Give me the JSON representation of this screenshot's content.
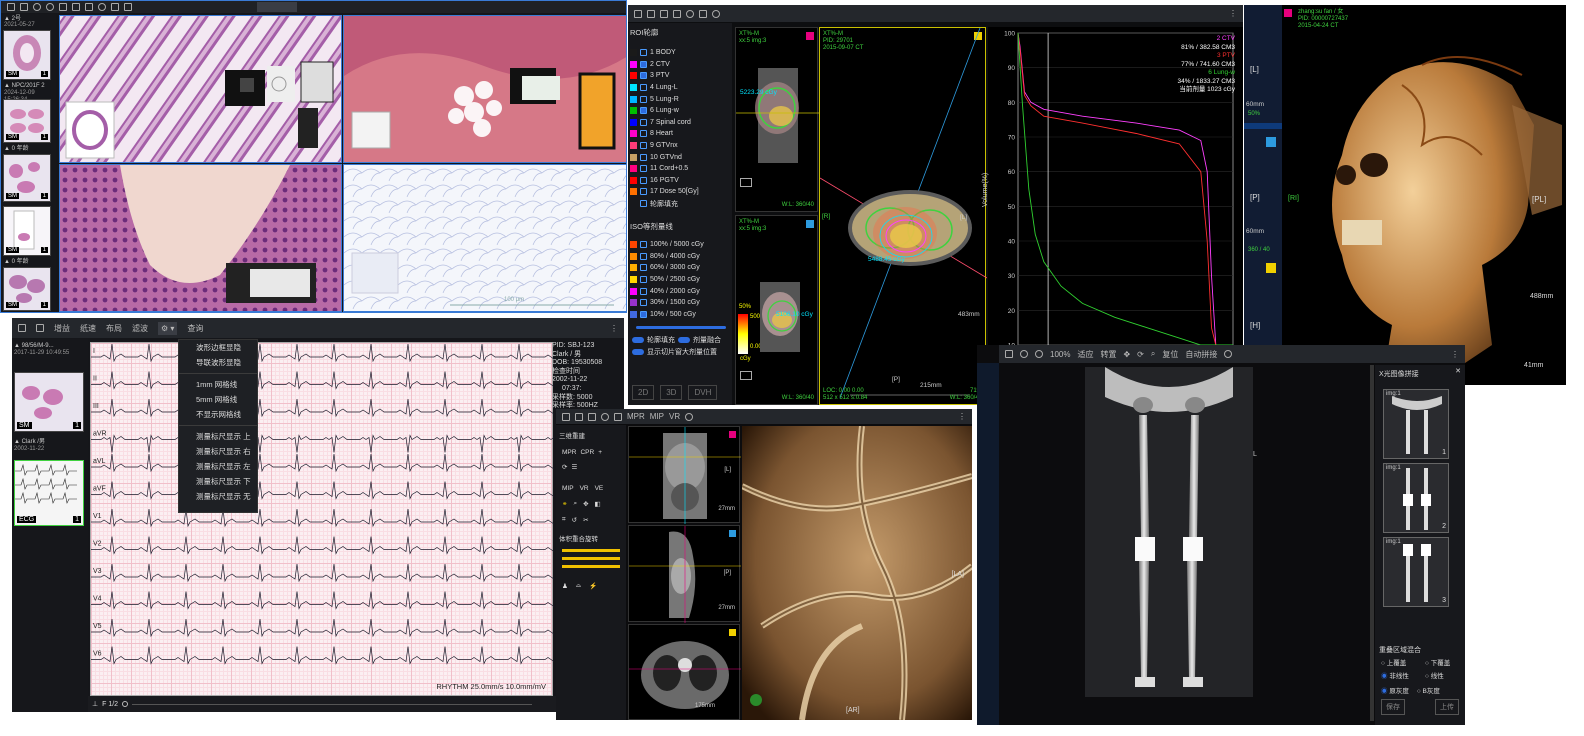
{
  "colors": {
    "accent": "#2d6cdf",
    "green": "#3fd23f",
    "yellow": "#f0d000",
    "magenta": "#e6007e"
  },
  "pathology": {
    "sidebar": {
      "header_line1": "▲ 2号",
      "header_line2": "2021-05-27",
      "group2_line1": "▲ NPC/201F 2",
      "group2_line2": "2024-12-09 15:26:34",
      "group3_line1": "▲ 0 年龄",
      "group4_line1": "▲ 0 年龄",
      "thumbs": [
        {
          "tag": "SM",
          "num": "1"
        },
        {
          "tag": "SM",
          "num": "1"
        },
        {
          "tag": "SM",
          "num": "1"
        },
        {
          "tag": "SM",
          "num": "1"
        },
        {
          "tag": "SM",
          "num": "1"
        }
      ]
    },
    "scale_label": "100 μm"
  },
  "rt": {
    "toolbar_icons": [
      "layout-icon",
      "grid-icon",
      "pointer-icon",
      "window-icon",
      "zoom-icon",
      "ruler-icon",
      "close-icon"
    ],
    "roi_title": "ROI轮廓",
    "roi_items": [
      {
        "label": "1 BODY",
        "color": "#1a1a1a",
        "checked": false
      },
      {
        "label": "2 CTV",
        "color": "#ff00ff",
        "checked": true
      },
      {
        "label": "3 PTV",
        "color": "#ff0000",
        "checked": true
      },
      {
        "label": "4 Lung-L",
        "color": "#00e5ff",
        "checked": false
      },
      {
        "label": "5 Lung-R",
        "color": "#00b7ff",
        "checked": false
      },
      {
        "label": "6 Lung-w",
        "color": "#00c000",
        "checked": true
      },
      {
        "label": "7 Spinal cord",
        "color": "#0000ff",
        "checked": false
      },
      {
        "label": "8 Heart",
        "color": "#ff00c8",
        "checked": false
      },
      {
        "label": "9 GTVnx",
        "color": "#ff3c78",
        "checked": false
      },
      {
        "label": "10 GTVnd",
        "color": "#c8a064",
        "checked": false
      },
      {
        "label": "11 Cord+0.5",
        "color": "#ff0080",
        "checked": false
      },
      {
        "label": "16 PGTV",
        "color": "#ff0000",
        "checked": false
      },
      {
        "label": "17 Dose 50[Gy]",
        "color": "#ff7000",
        "checked": false
      },
      {
        "label": "轮廓填充",
        "color": "",
        "checked": false
      }
    ],
    "iso_title": "ISO等剂量线",
    "iso_items": [
      {
        "label": "100% / 5000 cGy",
        "color": "#ff4500",
        "checked": false
      },
      {
        "label": "80% / 4000 cGy",
        "color": "#ff8c00",
        "checked": false
      },
      {
        "label": "60% / 3000 cGy",
        "color": "#ffb000",
        "checked": false
      },
      {
        "label": "50% / 2500 cGy",
        "color": "#ffd700",
        "checked": false
      },
      {
        "label": "40% / 2000 cGy",
        "color": "#ff00ff",
        "checked": false
      },
      {
        "label": "30% / 1500 cGy",
        "color": "#9932cc",
        "checked": false
      },
      {
        "label": "10% / 500 cGy",
        "color": "#4169e1",
        "checked": true
      }
    ],
    "toggle1_a": "轮廓填充",
    "toggle1_b": "剂量融合",
    "toggle2": "显示切片窗大剂量位置",
    "buttons": [
      "2D",
      "3D",
      "DVH"
    ],
    "view1_info": "XT%-M\nxx:5 img:3",
    "view_bottom": "W:L: 360/40",
    "dose_scale": [
      "50%",
      "5000",
      "0.00",
      "cGy"
    ],
    "axial_labels": {
      "r": "[R]",
      "l": "[L]",
      "p": "[P]",
      "a": "[A]"
    },
    "axial_info": "XT%-M\nPID: 29701\n2015-09-07 CT",
    "dose_label_1": "5488.45 cGy",
    "dose_label_2": "5223.29 cGy",
    "dose_label_3": "5106.10 cGy",
    "ruler_label": "215mm",
    "size_label": "483mm",
    "loc_label": "LOC: 0.00 0.00\n512 x 512 s:0.84",
    "pct_label": "71%\nW:L: 360/40",
    "dvh": {
      "ylabel": "Volume(%)",
      "legend": [
        {
          "text": "2 CTV",
          "color": "#ff40ff"
        },
        {
          "text": "81% / 382.58 CM3",
          "color": "#ffffff"
        },
        {
          "text": "3 PTV",
          "color": "#ff3030"
        },
        {
          "text": "77% / 741.60 CM3",
          "color": "#ffffff"
        },
        {
          "text": "6 Lung-w",
          "color": "#30d030"
        },
        {
          "text": "34% / 1833.27 CM3",
          "color": "#ffffff"
        },
        {
          "text": "当前剂量 1023 cGy",
          "color": "#ffffff"
        }
      ]
    }
  },
  "chart_data": {
    "type": "line",
    "title": "",
    "xlabel": "",
    "ylabel": "Volume(%)",
    "ylim": [
      10,
      100
    ],
    "yticks": [
      100,
      90,
      80,
      70,
      60,
      50,
      40,
      30,
      20,
      10
    ],
    "x_domain": [
      0,
      100
    ],
    "series": [
      {
        "name": "2 CTV",
        "color": "#ff40ff",
        "x": [
          0,
          1,
          3,
          6,
          12,
          30,
          55,
          75,
          85,
          88,
          90,
          92,
          100
        ],
        "y": [
          100,
          96,
          83,
          80,
          78,
          76,
          74,
          72,
          69,
          60,
          30,
          10,
          10
        ]
      },
      {
        "name": "3 PTV",
        "color": "#ff3030",
        "x": [
          0,
          1,
          3,
          6,
          12,
          30,
          55,
          75,
          85,
          88,
          90,
          92,
          100
        ],
        "y": [
          100,
          95,
          82,
          79,
          76,
          74,
          71,
          68,
          60,
          40,
          15,
          10,
          10
        ]
      },
      {
        "name": "6 Lung-w",
        "color": "#30d030",
        "x": [
          0,
          2,
          5,
          8,
          12,
          20,
          30,
          45,
          60,
          75,
          85,
          100
        ],
        "y": [
          100,
          80,
          55,
          42,
          34,
          27,
          22,
          18,
          15,
          12,
          10,
          10
        ]
      }
    ],
    "cursor_x": 14
  },
  "skull3d": {
    "info": "zhang:su fan / 女\nPID: 00000727437\n2015-04-24 CT",
    "orient": {
      "l": "[L]",
      "pl": "[PL]",
      "p": "[P]",
      "ri": "[RI]",
      "h": "[H]"
    },
    "side_labels": [
      "60mm",
      "50%",
      "360 / 40"
    ],
    "size_label": "488mm",
    "bottom_label": "41mm",
    "scale2": "60mm"
  },
  "ecg": {
    "toolbar": [
      "增益",
      "纸速",
      "布局",
      "滤波",
      "设置",
      "查询"
    ],
    "sidebar": {
      "group1_line1": "▲ 98/56/M-9...",
      "group1_line2": "2017-11-29 10:49:55",
      "group1_tag": "SM",
      "group1_num": "1",
      "group2_line1": "▲ Clark /男",
      "group2_line2": "2002-11-22",
      "group2_tag": "ECG",
      "group2_num": "1"
    },
    "leads": [
      "I",
      "II",
      "III",
      "aVR",
      "aVL",
      "aVF",
      "V1",
      "V2",
      "V3",
      "V4",
      "V5",
      "V6"
    ],
    "patient": {
      "pid": "PID: SBJ-123",
      "name": "Clark / 男",
      "dob": "DOB: 19530508",
      "exam": "检查时间",
      "date": "2002-11-22",
      "time": "07:37:",
      "samples": "采样数: 5000",
      "rate": "采样率: 500HZ"
    },
    "rhythm": "RHYTHM 25.0mm/s 10.0mm/mV",
    "page": "F 1/2",
    "menu": [
      "波形边框显隐",
      "导联波形显隐",
      "1mm 网格线",
      "5mm 网格线",
      "不显示网格线",
      "测量标尺显示 上",
      "测量标尺显示 右",
      "测量标尺显示 左",
      "测量标尺显示 下",
      "测量标尺显示 无"
    ]
  },
  "mpr": {
    "toolbar": [
      "MPR",
      "MIP",
      "VR"
    ],
    "panel_title": "三维重建",
    "row1": [
      "MPR",
      "CPR"
    ],
    "row2": [
      "MIP",
      "VR",
      "VE"
    ],
    "section2": "体积重合旋转",
    "views": [
      {
        "lbl": "[L]",
        "mm": "27mm",
        "sub": "[P]"
      },
      {
        "lbl": "[P]",
        "mm": "27mm",
        "sub": ""
      },
      {
        "lbl": "[L]",
        "mm": "175mm",
        "sub": ""
      }
    ],
    "vr_labels": {
      "la": "[LA]",
      "ar": "[AR]"
    }
  },
  "xray": {
    "toolbar": [
      "100%",
      "适应",
      "转置",
      "复位",
      "自动拼接"
    ],
    "side_title": "X光图像拼接",
    "thumbs": [
      {
        "lbl": "img:1",
        "n": "1"
      },
      {
        "lbl": "img:1",
        "n": "2"
      },
      {
        "lbl": "img:1",
        "n": "3"
      }
    ],
    "overlap_title": "重叠区域混合",
    "opts": [
      "上覆盖",
      "下覆盖",
      "非线性",
      "线性"
    ],
    "gray_opts": [
      "原灰度",
      "B灰度"
    ],
    "buttons": [
      "保存",
      "上传"
    ],
    "lr": "L"
  }
}
